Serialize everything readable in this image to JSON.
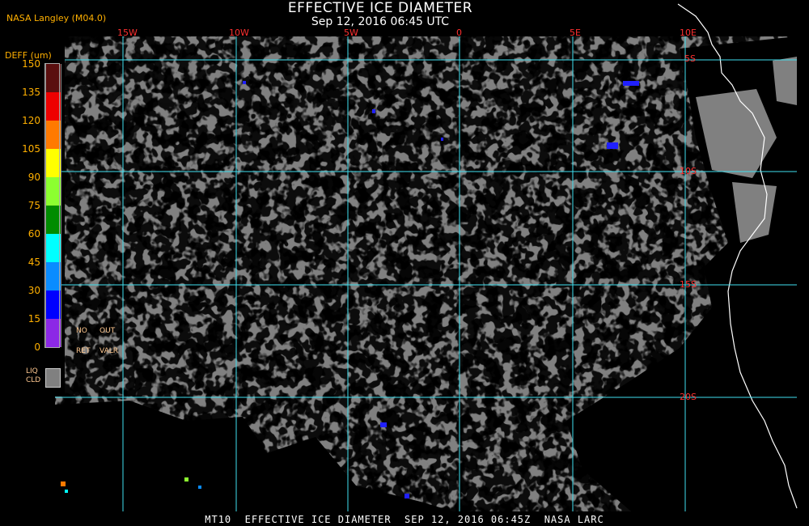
{
  "header": {
    "org_label": "NASA Langley (M04.0)",
    "title": "EFFECTIVE ICE DIAMETER",
    "subtitle": "Sep 12, 2016 06:45 UTC"
  },
  "legend": {
    "title": "DEFF (um)",
    "ticks": [
      "150",
      "135",
      "120",
      "105",
      "90",
      "75",
      "60",
      "45",
      "30",
      "15",
      "0"
    ],
    "colors": [
      "#5a0f0f",
      "#ee0000",
      "#ff7a00",
      "#ffff00",
      "#8cff30",
      "#008c00",
      "#00ffff",
      "#0a8cff",
      "#0000ff",
      "#8c28e6"
    ],
    "no_ret_labels": [
      "NO",
      "RET"
    ],
    "out_valr_labels": [
      "OUT",
      "VALR"
    ],
    "liq_cld_labels": [
      "LIQ",
      "CLD"
    ],
    "liq_color": "#808080"
  },
  "grid": {
    "longitude_labels": [
      "15W",
      "10W",
      "5W",
      "0",
      "5E",
      "10E"
    ],
    "latitude_labels": [
      "5S",
      "10S",
      "15S",
      "20S"
    ],
    "grid_color": "#40e0f0",
    "label_color": "#ff3030"
  },
  "map": {
    "background": "#808080",
    "clear_color": "#000000",
    "coast_color": "#ffffff"
  },
  "footer": {
    "text": "MT10  EFFECTIVE ICE DIAMETER  SEP 12, 2016 06:45Z  NASA LARC"
  }
}
